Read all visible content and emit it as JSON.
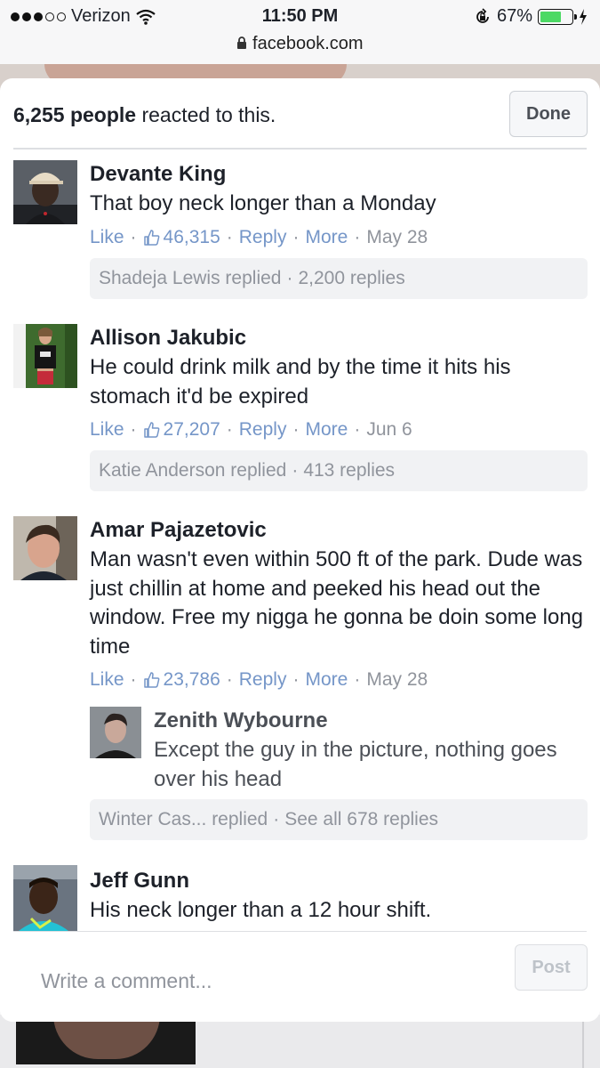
{
  "status_bar": {
    "carrier": "Verizon",
    "time": "11:50 PM",
    "battery": "67%",
    "battery_level": 0.67,
    "url": "facebook.com",
    "icons": [
      "signal-dots-icon",
      "wifi-icon",
      "lock-icon",
      "rotation-lock-icon",
      "battery-icon",
      "charging-icon"
    ]
  },
  "header": {
    "count": "6,255 people",
    "suffix": " reacted to this.",
    "done_label": "Done"
  },
  "actions": {
    "like": "Like",
    "reply": "Reply",
    "more": "More",
    "separator": "·"
  },
  "comments": [
    {
      "name": "Devante King",
      "text": "That boy neck longer than a Monday",
      "likes": "46,315",
      "date": "May 28",
      "replies_summary": {
        "who": "Shadeja Lewis replied",
        "count": "2,200 replies"
      }
    },
    {
      "name": "Allison Jakubic",
      "text": "He could drink milk and by the time it hits his stomach it'd be expired",
      "likes": "27,207",
      "date": "Jun 6",
      "replies_summary": {
        "who": "Katie Anderson replied",
        "count": "413 replies"
      }
    },
    {
      "name": "Amar Pajazetovic",
      "text": "Man wasn't even within 500 ft of the park. Dude was just chillin at home and peeked his head out the window. Free my nigga he gonna be doin some long time",
      "likes": "23,786",
      "date": "May 28",
      "reply": {
        "name": "Zenith Wybourne",
        "text": "Except the guy in the picture, nothing goes over his head"
      },
      "replies_summary": {
        "who": "Winter Cas... replied",
        "count": "See all 678 replies"
      }
    },
    {
      "name": "Jeff Gunn",
      "text": "His neck longer than a 12 hour shift."
    }
  ],
  "composer": {
    "placeholder": "Write a comment...",
    "post_label": "Post"
  },
  "colors": {
    "link": "#7596c8",
    "meta": "#90949c",
    "text": "#1d2129",
    "battery": "#4cd964"
  }
}
